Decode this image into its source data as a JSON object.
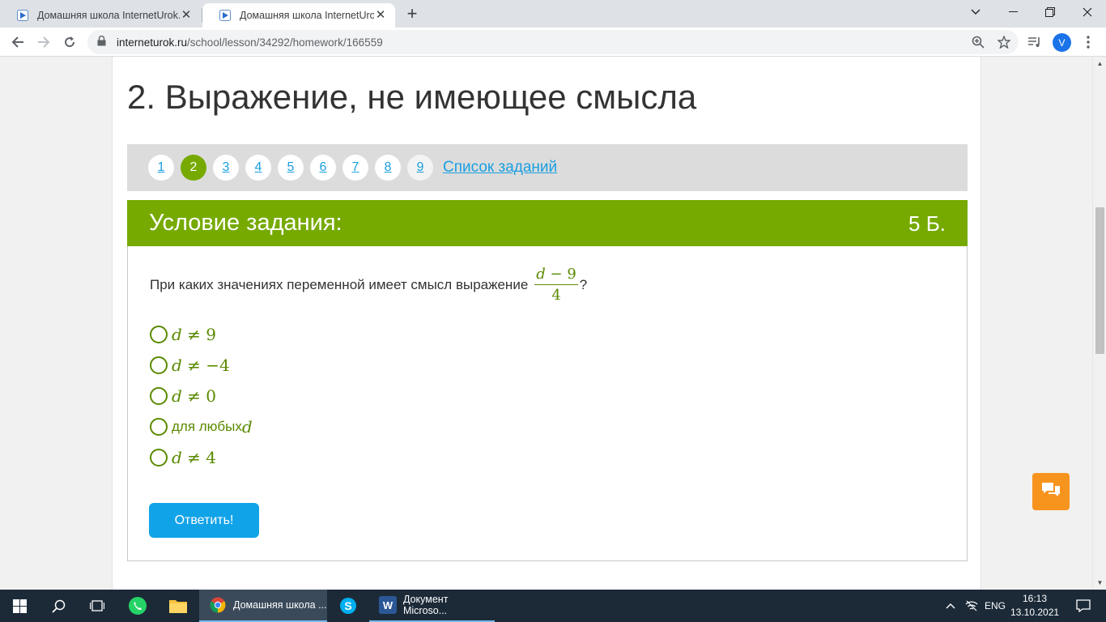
{
  "browser": {
    "tabs": [
      {
        "title": "Домашняя школа InternetUrok.r",
        "active": false
      },
      {
        "title": "Домашняя школа InternetUrok.r",
        "active": true
      }
    ],
    "url_host": "interneturok.ru",
    "url_path": "/school/lesson/34292/homework/166559",
    "profile_initial": "V"
  },
  "page": {
    "lesson_title": "2. Выражение, не имеющее смысла",
    "pager": {
      "pages": [
        "1",
        "2",
        "3",
        "4",
        "5",
        "6",
        "7",
        "8",
        "9"
      ],
      "current": "2",
      "task_list_label": "Список заданий"
    },
    "task": {
      "header_label": "Условие задания:",
      "score": "5 Б.",
      "question_text": "При каких значениях переменной имеет смысл выражение",
      "fraction_var": "d",
      "fraction_rest": " − 9",
      "fraction_den": "4",
      "question_end": "?",
      "options": [
        {
          "var": "d",
          "rest": " ≠ 9"
        },
        {
          "var": "d",
          "rest": " ≠ −4"
        },
        {
          "var": "d",
          "rest": " ≠ 0"
        },
        {
          "text": "для любых ",
          "var": "d"
        },
        {
          "var": "d",
          "rest": " ≠ 4"
        }
      ],
      "submit_label": "Ответить!"
    }
  },
  "taskbar": {
    "apps": [
      {
        "label": "Домашняя школа ..."
      },
      {
        "label": "Документ Microso..."
      }
    ],
    "language": "ENG",
    "time": "16:13",
    "date": "13.10.2021"
  },
  "colors": {
    "accent_green": "#76aa00",
    "link_blue": "#1a9fe0",
    "button_blue": "#11a3e8",
    "chat_orange": "#f7941d"
  }
}
